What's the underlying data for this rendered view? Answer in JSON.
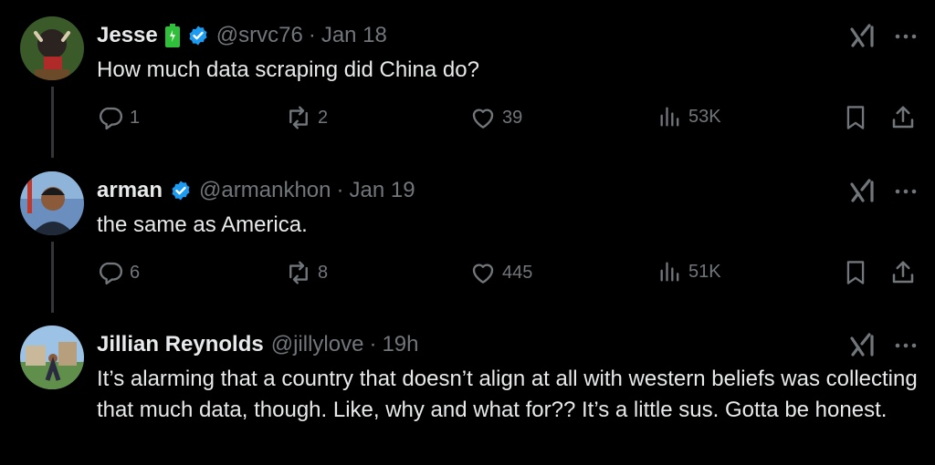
{
  "tweets": [
    {
      "name": "Jesse",
      "verified": true,
      "handle": "@srvc76",
      "time": "Jan 18",
      "text": "How much data scraping did China do?",
      "replies": "1",
      "reposts": "2",
      "likes": "39",
      "views": "53K"
    },
    {
      "name": "arman",
      "verified": true,
      "handle": "@armankhon",
      "time": "Jan 19",
      "text": "the same as America.",
      "replies": "6",
      "reposts": "8",
      "likes": "445",
      "views": "51K"
    },
    {
      "name": "Jillian Reynolds",
      "verified": false,
      "handle": "@jillylove",
      "time": "19h",
      "text": "It’s alarming that a country that doesn’t align at all with western beliefs was collecting that much data, though. Like, why and what for?? It’s a little sus. Gotta be honest."
    }
  ],
  "separator": "·",
  "icons": {
    "badge": "verified-badge-icon",
    "grok": "grok-icon",
    "more": "more-options-icon",
    "reply": "reply-icon",
    "repost": "repost-icon",
    "like": "like-icon",
    "views": "views-icon",
    "bookmark": "bookmark-icon",
    "share": "share-icon"
  },
  "colors": {
    "background": "#000000",
    "text": "#e7e9ea",
    "muted": "#71767b",
    "verified": "#1d9bf0",
    "battery": "#2fbf3a"
  }
}
